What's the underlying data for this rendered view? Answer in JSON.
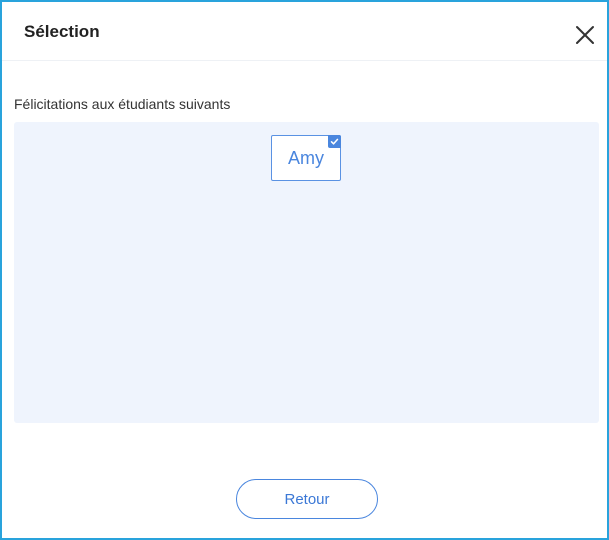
{
  "dialog": {
    "title": "Sélection",
    "subtitle": "Félicitations aux étudiants suivants",
    "students": [
      {
        "name": "Amy",
        "selected": true
      }
    ],
    "back_label": "Retour"
  },
  "icons": {
    "close": "close-icon",
    "check": "check-icon"
  },
  "colors": {
    "frame_border": "#29a3dc",
    "accent": "#4a86de",
    "panel_bg": "#eff4fd"
  }
}
